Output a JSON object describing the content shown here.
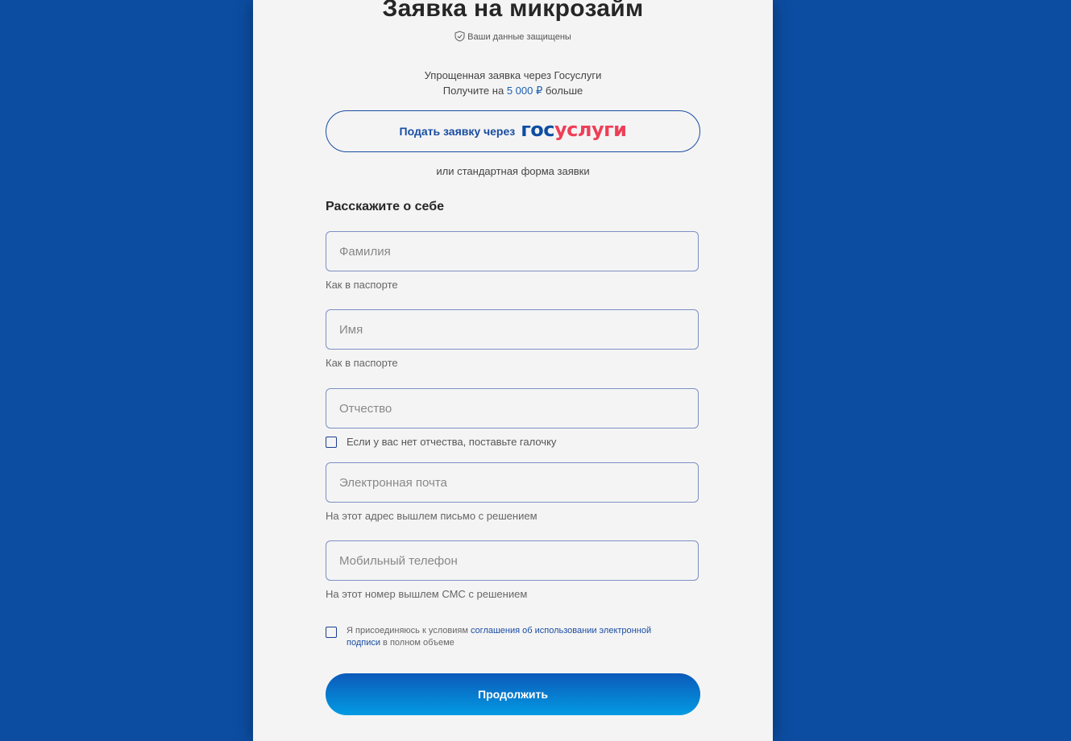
{
  "header": {
    "title": "Заявка на микрозайм",
    "secure_note": "Ваши данные защищены"
  },
  "promo": {
    "line1": "Упрощенная заявка через Госуслуги",
    "line2_prefix": "Получите на ",
    "line2_amount": "5 000 ₽",
    "line2_suffix": " больше"
  },
  "gosuslugi_button": {
    "label": "Подать заявку через",
    "logo_part1": "гос",
    "logo_part2": "услуги"
  },
  "or_text": "или стандартная форма заявки",
  "section_title": "Расскажите о себе",
  "fields": {
    "surname": {
      "placeholder": "Фамилия",
      "value": "",
      "hint": "Как в паспорте"
    },
    "name": {
      "placeholder": "Имя",
      "value": "",
      "hint": "Как в паспорте"
    },
    "patronymic": {
      "placeholder": "Отчество",
      "value": "",
      "checkbox_label": "Если у вас нет отчества, поставьте галочку",
      "checked": false
    },
    "email": {
      "placeholder": "Электронная почта",
      "value": "",
      "hint": "На этот адрес вышлем письмо с решением"
    },
    "phone": {
      "placeholder": "Мобильный телефон",
      "value": "",
      "hint": "На этот номер вышлем СМС с решением"
    }
  },
  "agreement": {
    "prefix": "Я присоединяюсь к условиям ",
    "link": "соглашения об использовании электронной подписи",
    "suffix": " в полном объеме",
    "checked": false
  },
  "submit_label": "Продолжить",
  "colors": {
    "page_background": "#0c4da2",
    "card_background": "#f4f4f4",
    "accent_blue": "#1a4da2",
    "gos_red": "#ee3f58",
    "submit_gradient_top": "#0b59b9",
    "submit_gradient_bottom": "#039be3"
  }
}
